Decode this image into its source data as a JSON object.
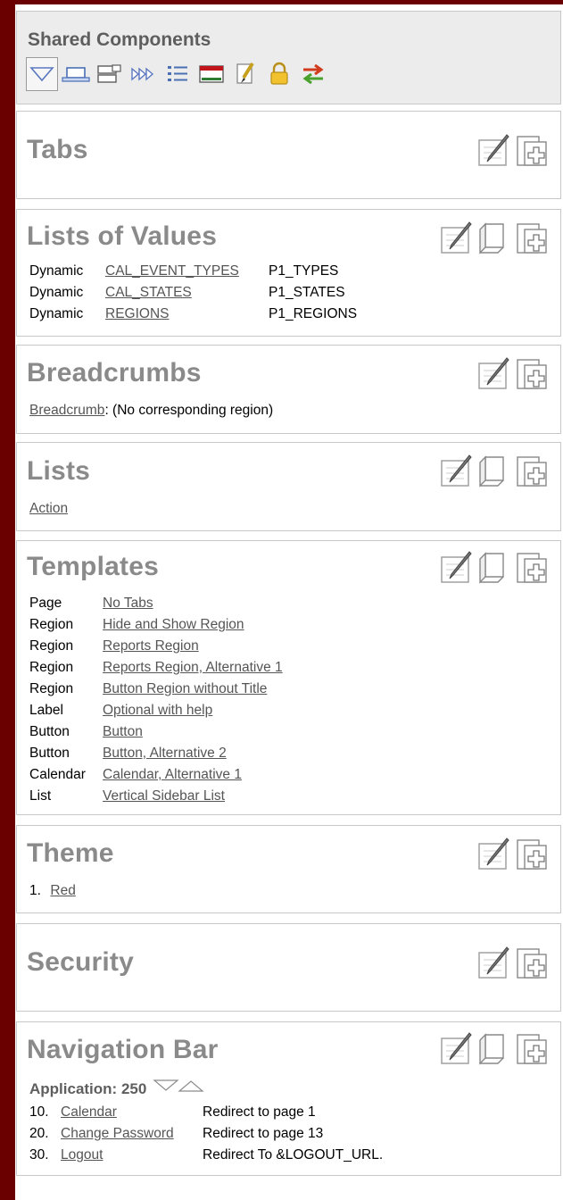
{
  "shared": {
    "title": "Shared Components",
    "icons": [
      "triangle-down-icon",
      "window-icon",
      "region-icon",
      "arrows-icon",
      "list-icon",
      "template-icon",
      "theme-brush-icon",
      "lock-icon",
      "swap-arrows-icon"
    ]
  },
  "tabs": {
    "title": "Tabs"
  },
  "lov": {
    "title": "Lists of Values",
    "rows": [
      {
        "type": "Dynamic",
        "name": "CAL_EVENT_TYPES",
        "item": "P1_TYPES"
      },
      {
        "type": "Dynamic",
        "name": "CAL_STATES",
        "item": "P1_STATES"
      },
      {
        "type": "Dynamic",
        "name": "REGIONS",
        "item": "P1_REGIONS"
      }
    ]
  },
  "breadcrumbs": {
    "title": "Breadcrumbs",
    "link": "Breadcrumb",
    "text": ": (No corresponding region)"
  },
  "lists": {
    "title": "Lists",
    "link": "Action"
  },
  "templates": {
    "title": "Templates",
    "rows": [
      {
        "type": "Page",
        "name": "No Tabs"
      },
      {
        "type": "Region",
        "name": "Hide and Show Region"
      },
      {
        "type": "Region",
        "name": "Reports Region"
      },
      {
        "type": "Region",
        "name": "Reports Region, Alternative 1"
      },
      {
        "type": "Region",
        "name": "Button Region without Title"
      },
      {
        "type": "Label",
        "name": "Optional with help"
      },
      {
        "type": "Button",
        "name": "Button"
      },
      {
        "type": "Button",
        "name": "Button, Alternative 2"
      },
      {
        "type": "Calendar",
        "name": "Calendar, Alternative 1"
      },
      {
        "type": "List",
        "name": "Vertical Sidebar List"
      }
    ]
  },
  "theme": {
    "title": "Theme",
    "num": "1.",
    "link": "Red"
  },
  "security": {
    "title": "Security"
  },
  "navbar": {
    "title": "Navigation Bar",
    "app_label": "Application: 250",
    "rows": [
      {
        "num": "10.",
        "name": "Calendar",
        "target": "Redirect to page 1"
      },
      {
        "num": "20.",
        "name": "Change Password",
        "target": "Redirect to page 13"
      },
      {
        "num": "30.",
        "name": "Logout",
        "target": "Redirect To &LOGOUT_URL."
      }
    ]
  }
}
